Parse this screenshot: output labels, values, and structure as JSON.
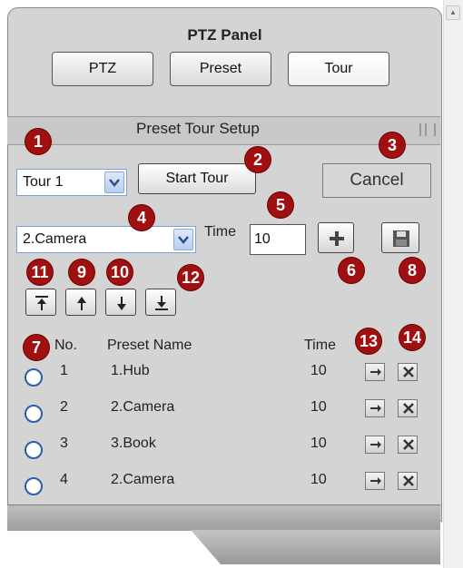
{
  "panel": {
    "title": "PTZ Panel"
  },
  "tabs": [
    {
      "label": "PTZ"
    },
    {
      "label": "Preset"
    },
    {
      "label": "Tour"
    }
  ],
  "section": {
    "title": "Preset Tour Setup"
  },
  "tour_select": {
    "value": "Tour 1"
  },
  "buttons": {
    "start_tour": "Start Tour",
    "cancel": "Cancel"
  },
  "preset_select": {
    "value": "2.Camera"
  },
  "time": {
    "label": "Time",
    "value": "10"
  },
  "table": {
    "headers": {
      "no": "No.",
      "name": "Preset Name",
      "time": "Time"
    },
    "rows": [
      {
        "no": "1",
        "name": "1.Hub",
        "time": "10"
      },
      {
        "no": "2",
        "name": "2.Camera",
        "time": "10"
      },
      {
        "no": "3",
        "name": "3.Book",
        "time": "10"
      },
      {
        "no": "4",
        "name": "2.Camera",
        "time": "10"
      }
    ]
  },
  "badges": [
    "1",
    "2",
    "3",
    "4",
    "5",
    "6",
    "7",
    "8",
    "9",
    "10",
    "11",
    "12",
    "13",
    "14"
  ],
  "icons": {
    "dropdown": "chevron-down-icon",
    "add": "plus-icon",
    "save": "floppy-disk-icon",
    "move_top": "arrow-to-top-icon",
    "move_up": "arrow-up-icon",
    "move_down": "arrow-down-icon",
    "move_bottom": "arrow-to-bottom-icon",
    "go": "arrow-right-icon",
    "delete": "close-icon"
  },
  "colors": {
    "panel": "#d4d4d4",
    "badge": "#a11010",
    "select_border": "#7aa0d6"
  }
}
